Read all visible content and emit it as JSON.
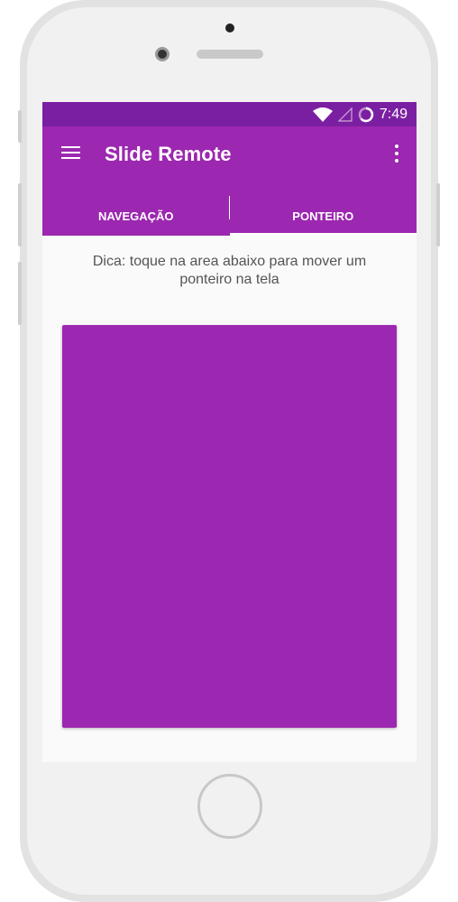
{
  "status_bar": {
    "time": "7:49",
    "icons": [
      "wifi-icon",
      "signal-icon",
      "battery-icon"
    ]
  },
  "app_bar": {
    "title": "Slide Remote",
    "menu_icon": "menu-icon",
    "overflow_icon": "overflow-icon"
  },
  "tabs": [
    {
      "label": "NAVEGAÇÃO",
      "selected": false
    },
    {
      "label": "PONTEIRO",
      "selected": true
    }
  ],
  "pointer_tab": {
    "hint": "Dica: toque na area abaixo para mover um ponteiro na tela"
  },
  "colors": {
    "primary": "#9c27b0",
    "primary_dark": "#7b1fa2",
    "background": "#fafafa"
  }
}
